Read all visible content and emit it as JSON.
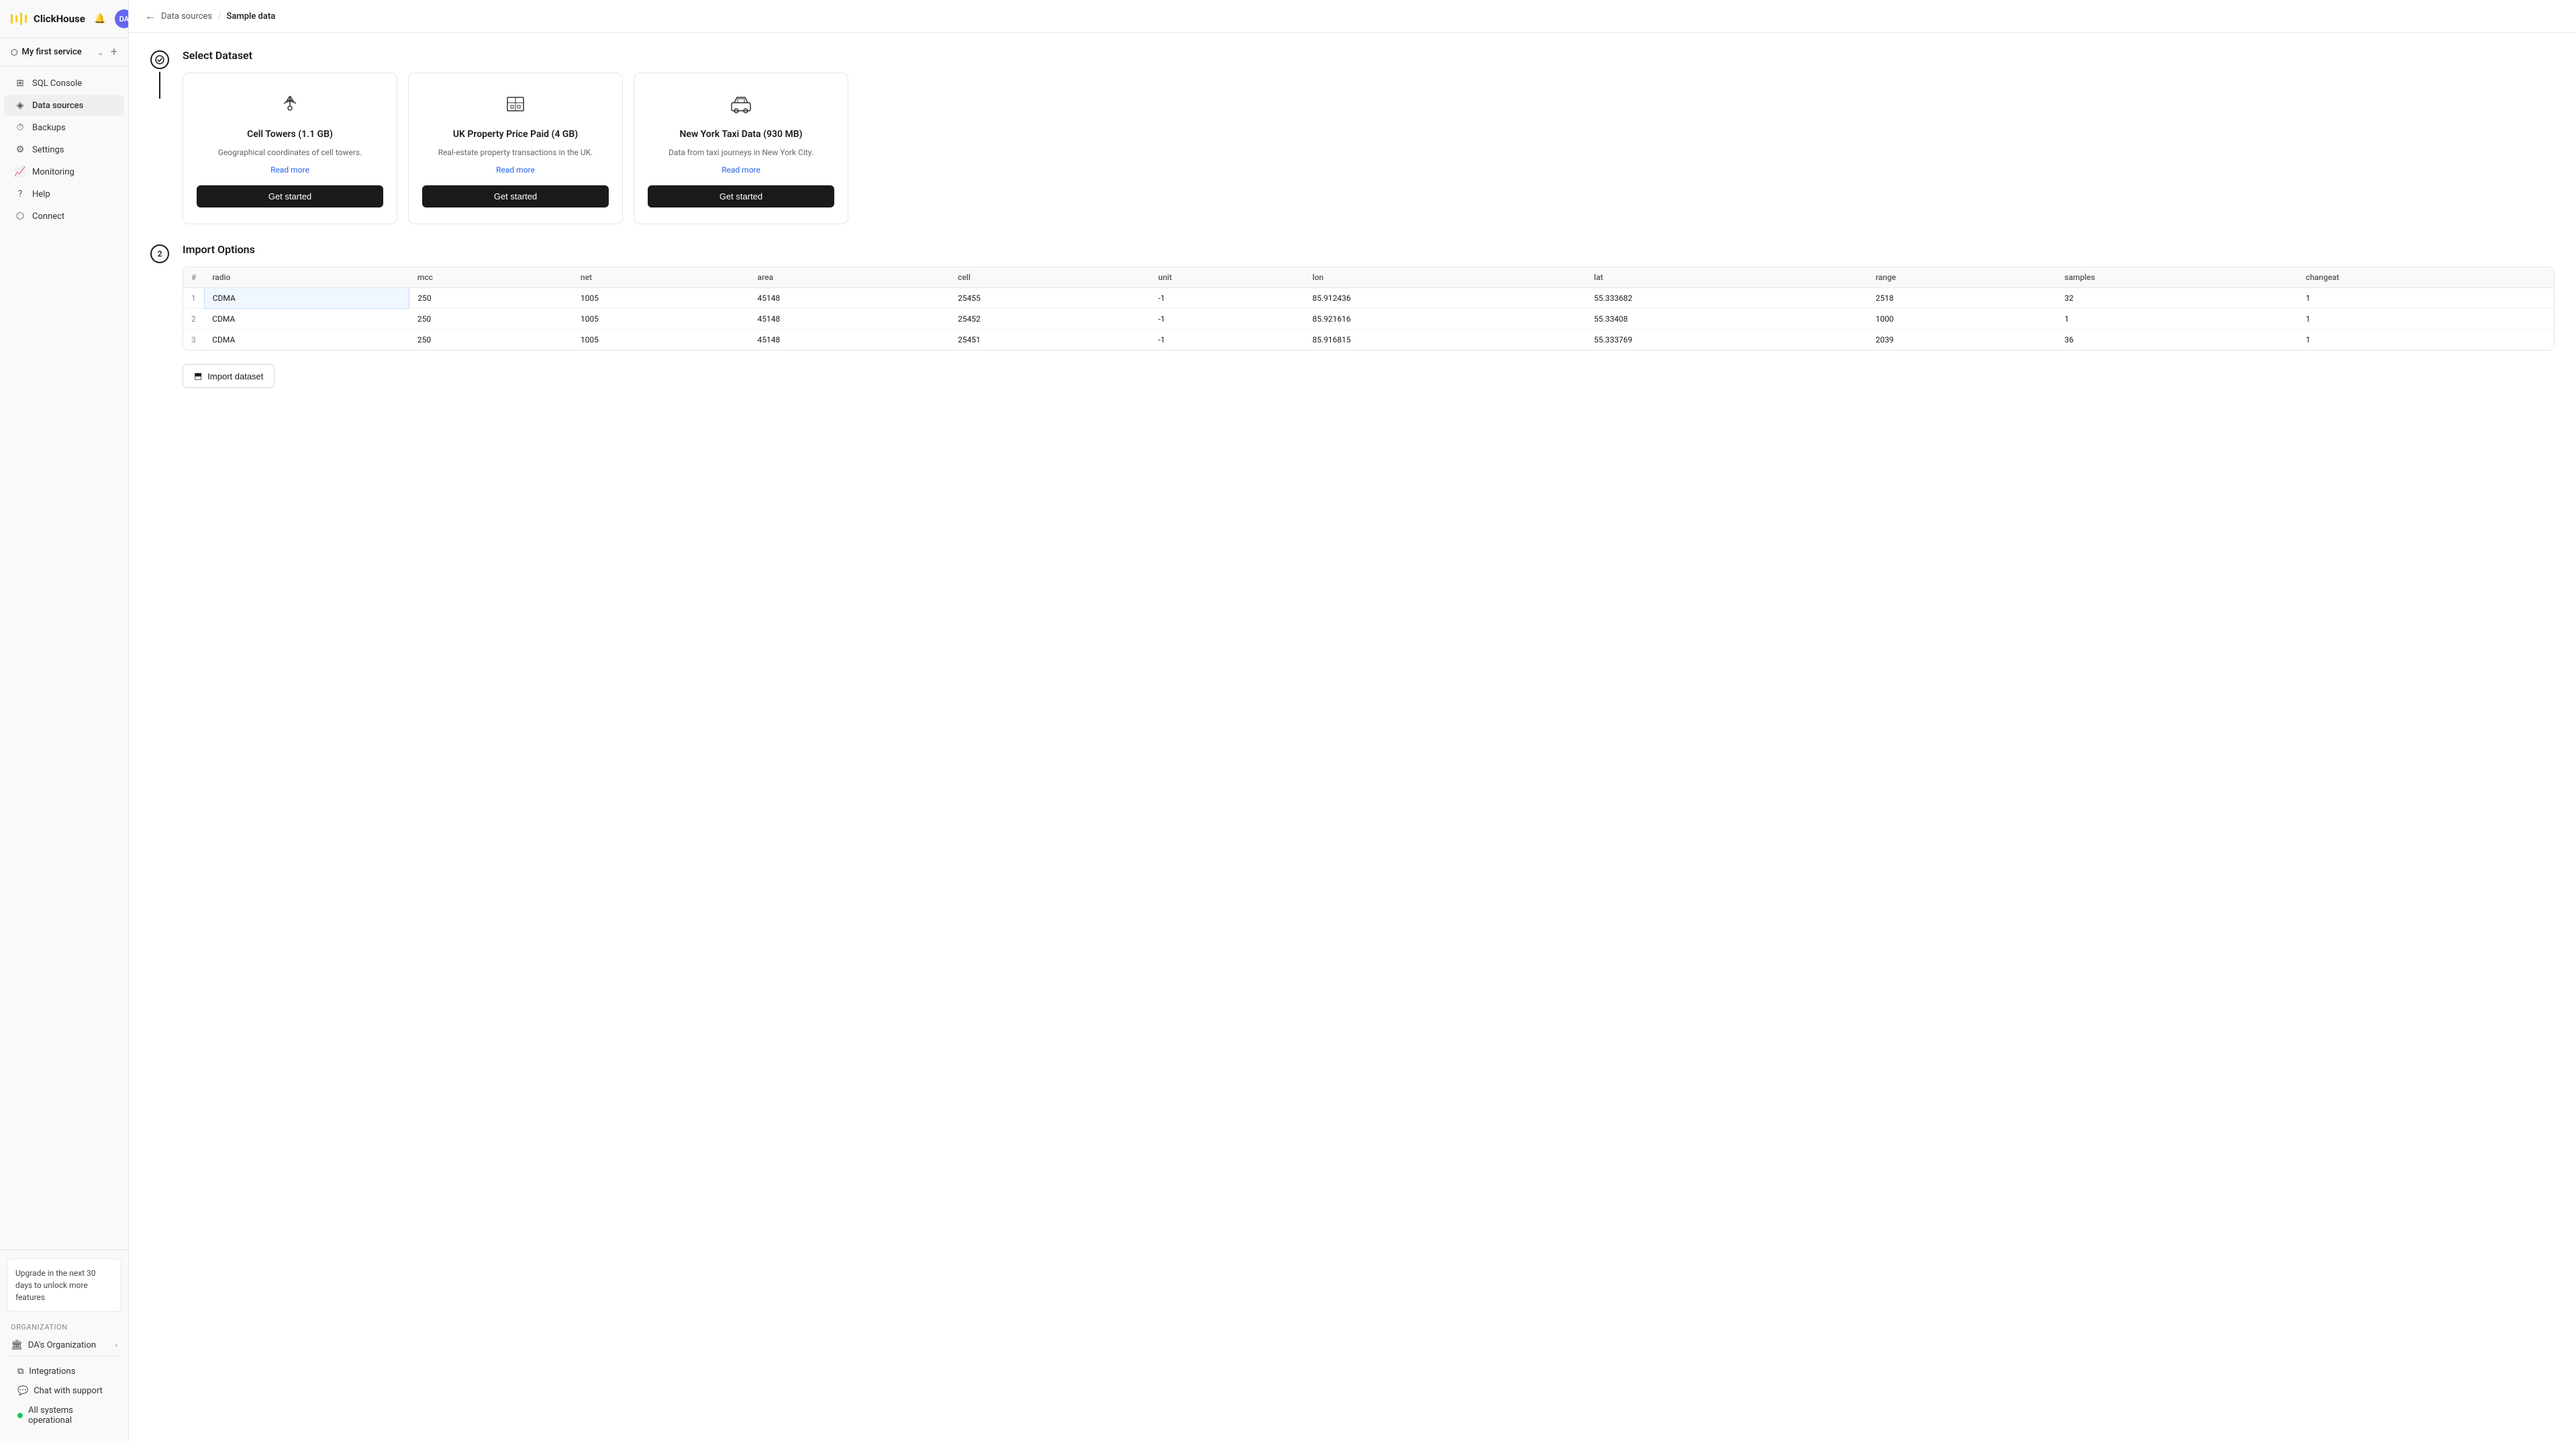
{
  "app": {
    "name": "ClickHouse"
  },
  "sidebar": {
    "service": "My first service",
    "nav_items": [
      {
        "id": "sql-console",
        "label": "SQL Console",
        "icon": "sql"
      },
      {
        "id": "data-sources",
        "label": "Data sources",
        "icon": "data",
        "active": true
      },
      {
        "id": "backups",
        "label": "Backups",
        "icon": "backup"
      },
      {
        "id": "settings",
        "label": "Settings",
        "icon": "settings"
      },
      {
        "id": "monitoring",
        "label": "Monitoring",
        "icon": "monitor"
      },
      {
        "id": "help",
        "label": "Help",
        "icon": "help"
      },
      {
        "id": "connect",
        "label": "Connect",
        "icon": "connect"
      }
    ],
    "upgrade_text": "Upgrade in the next 30 days to unlock more features",
    "org_label": "Organization",
    "org_name": "DA's Organization",
    "integrations_label": "Integrations",
    "chat_label": "Chat with support",
    "status_label": "All systems operational"
  },
  "topbar": {
    "back_label": "←",
    "breadcrumb_parent": "Data sources",
    "breadcrumb_separator": "/",
    "breadcrumb_current": "Sample data"
  },
  "step1": {
    "number": "✓",
    "title": "Select Dataset",
    "datasets": [
      {
        "id": "cell-towers",
        "title": "Cell Towers (1.1 GB)",
        "desc": "Geographical coordinates of cell towers.",
        "link": "Read more",
        "btn": "Get started",
        "icon": "📡"
      },
      {
        "id": "uk-property",
        "title": "UK Property Price Paid (4 GB)",
        "desc": "Real-estate property transactions in the UK.",
        "link": "Read more",
        "btn": "Get started",
        "icon": "🏢"
      },
      {
        "id": "ny-taxi",
        "title": "New York Taxi Data (930 MB)",
        "desc": "Data from taxi journeys in New York City.",
        "link": "Read more",
        "btn": "Get started",
        "icon": "🚕"
      }
    ]
  },
  "step2": {
    "number": "2",
    "title": "Import Options",
    "table": {
      "columns": [
        "#",
        "radio",
        "mcc",
        "net",
        "area",
        "cell",
        "unit",
        "lon",
        "lat",
        "range",
        "samples",
        "changeat"
      ],
      "rows": [
        {
          "num": "1",
          "radio": "CDMA",
          "mcc": "250",
          "net": "1005",
          "area": "45148",
          "cell": "25455",
          "unit": "-1",
          "lon": "85.912436",
          "lat": "55.333682",
          "range": "2518",
          "samples": "32",
          "changeat": "1"
        },
        {
          "num": "2",
          "radio": "CDMA",
          "mcc": "250",
          "net": "1005",
          "area": "45148",
          "cell": "25452",
          "unit": "-1",
          "lon": "85.921616",
          "lat": "55.33408",
          "range": "1000",
          "samples": "1",
          "changeat": "1"
        },
        {
          "num": "3",
          "radio": "CDMA",
          "mcc": "250",
          "net": "1005",
          "area": "45148",
          "cell": "25451",
          "unit": "-1",
          "lon": "85.916815",
          "lat": "55.333769",
          "range": "2039",
          "samples": "36",
          "changeat": "1"
        }
      ]
    },
    "import_btn": "Import dataset"
  }
}
